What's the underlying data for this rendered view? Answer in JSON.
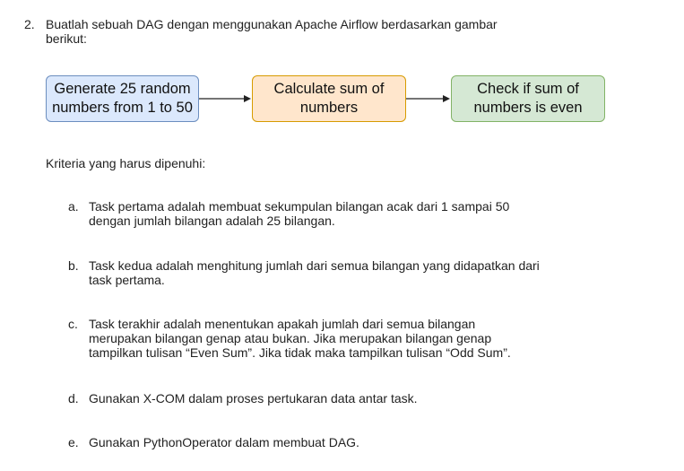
{
  "question": {
    "number": "2.",
    "lines": [
      "Buatlah sebuah DAG dengan menggunakan Apache Airflow berdasarkan gambar",
      "berikut:"
    ]
  },
  "flow": {
    "nodes": [
      {
        "lines": [
          "Generate 25 random",
          "numbers from 1 to 50"
        ],
        "fill": "#dbe8fc",
        "stroke": "#6c8ebf"
      },
      {
        "lines": [
          "Calculate sum of",
          "numbers"
        ],
        "fill": "#ffe6cc",
        "stroke": "#d79b00"
      },
      {
        "lines": [
          "Check if sum of",
          "numbers is even"
        ],
        "fill": "#d5e8d4",
        "stroke": "#82b366"
      }
    ]
  },
  "criteria": {
    "title": "Kriteria yang harus dipenuhi:",
    "items": [
      {
        "marker": "a.",
        "lines": [
          "Task pertama adalah membuat sekumpulan bilangan acak dari 1 sampai 50",
          "dengan jumlah bilangan adalah 25 bilangan."
        ]
      },
      {
        "marker": "b.",
        "lines": [
          "Task kedua adalah menghitung jumlah dari semua bilangan yang didapatkan dari",
          "task pertama."
        ]
      },
      {
        "marker": "c.",
        "lines": [
          "Task terakhir adalah menentukan apakah jumlah dari semua bilangan",
          "merupakan bilangan genap atau bukan. Jika merupakan bilangan genap",
          "tampilkan tulisan “Even Sum”. Jika tidak maka tampilkan tulisan “Odd Sum”."
        ]
      },
      {
        "marker": "d.",
        "lines": [
          "Gunakan X-COM dalam proses pertukaran data antar task."
        ]
      },
      {
        "marker": "e.",
        "lines": [
          "Gunakan PythonOperator dalam membuat DAG."
        ]
      }
    ]
  }
}
